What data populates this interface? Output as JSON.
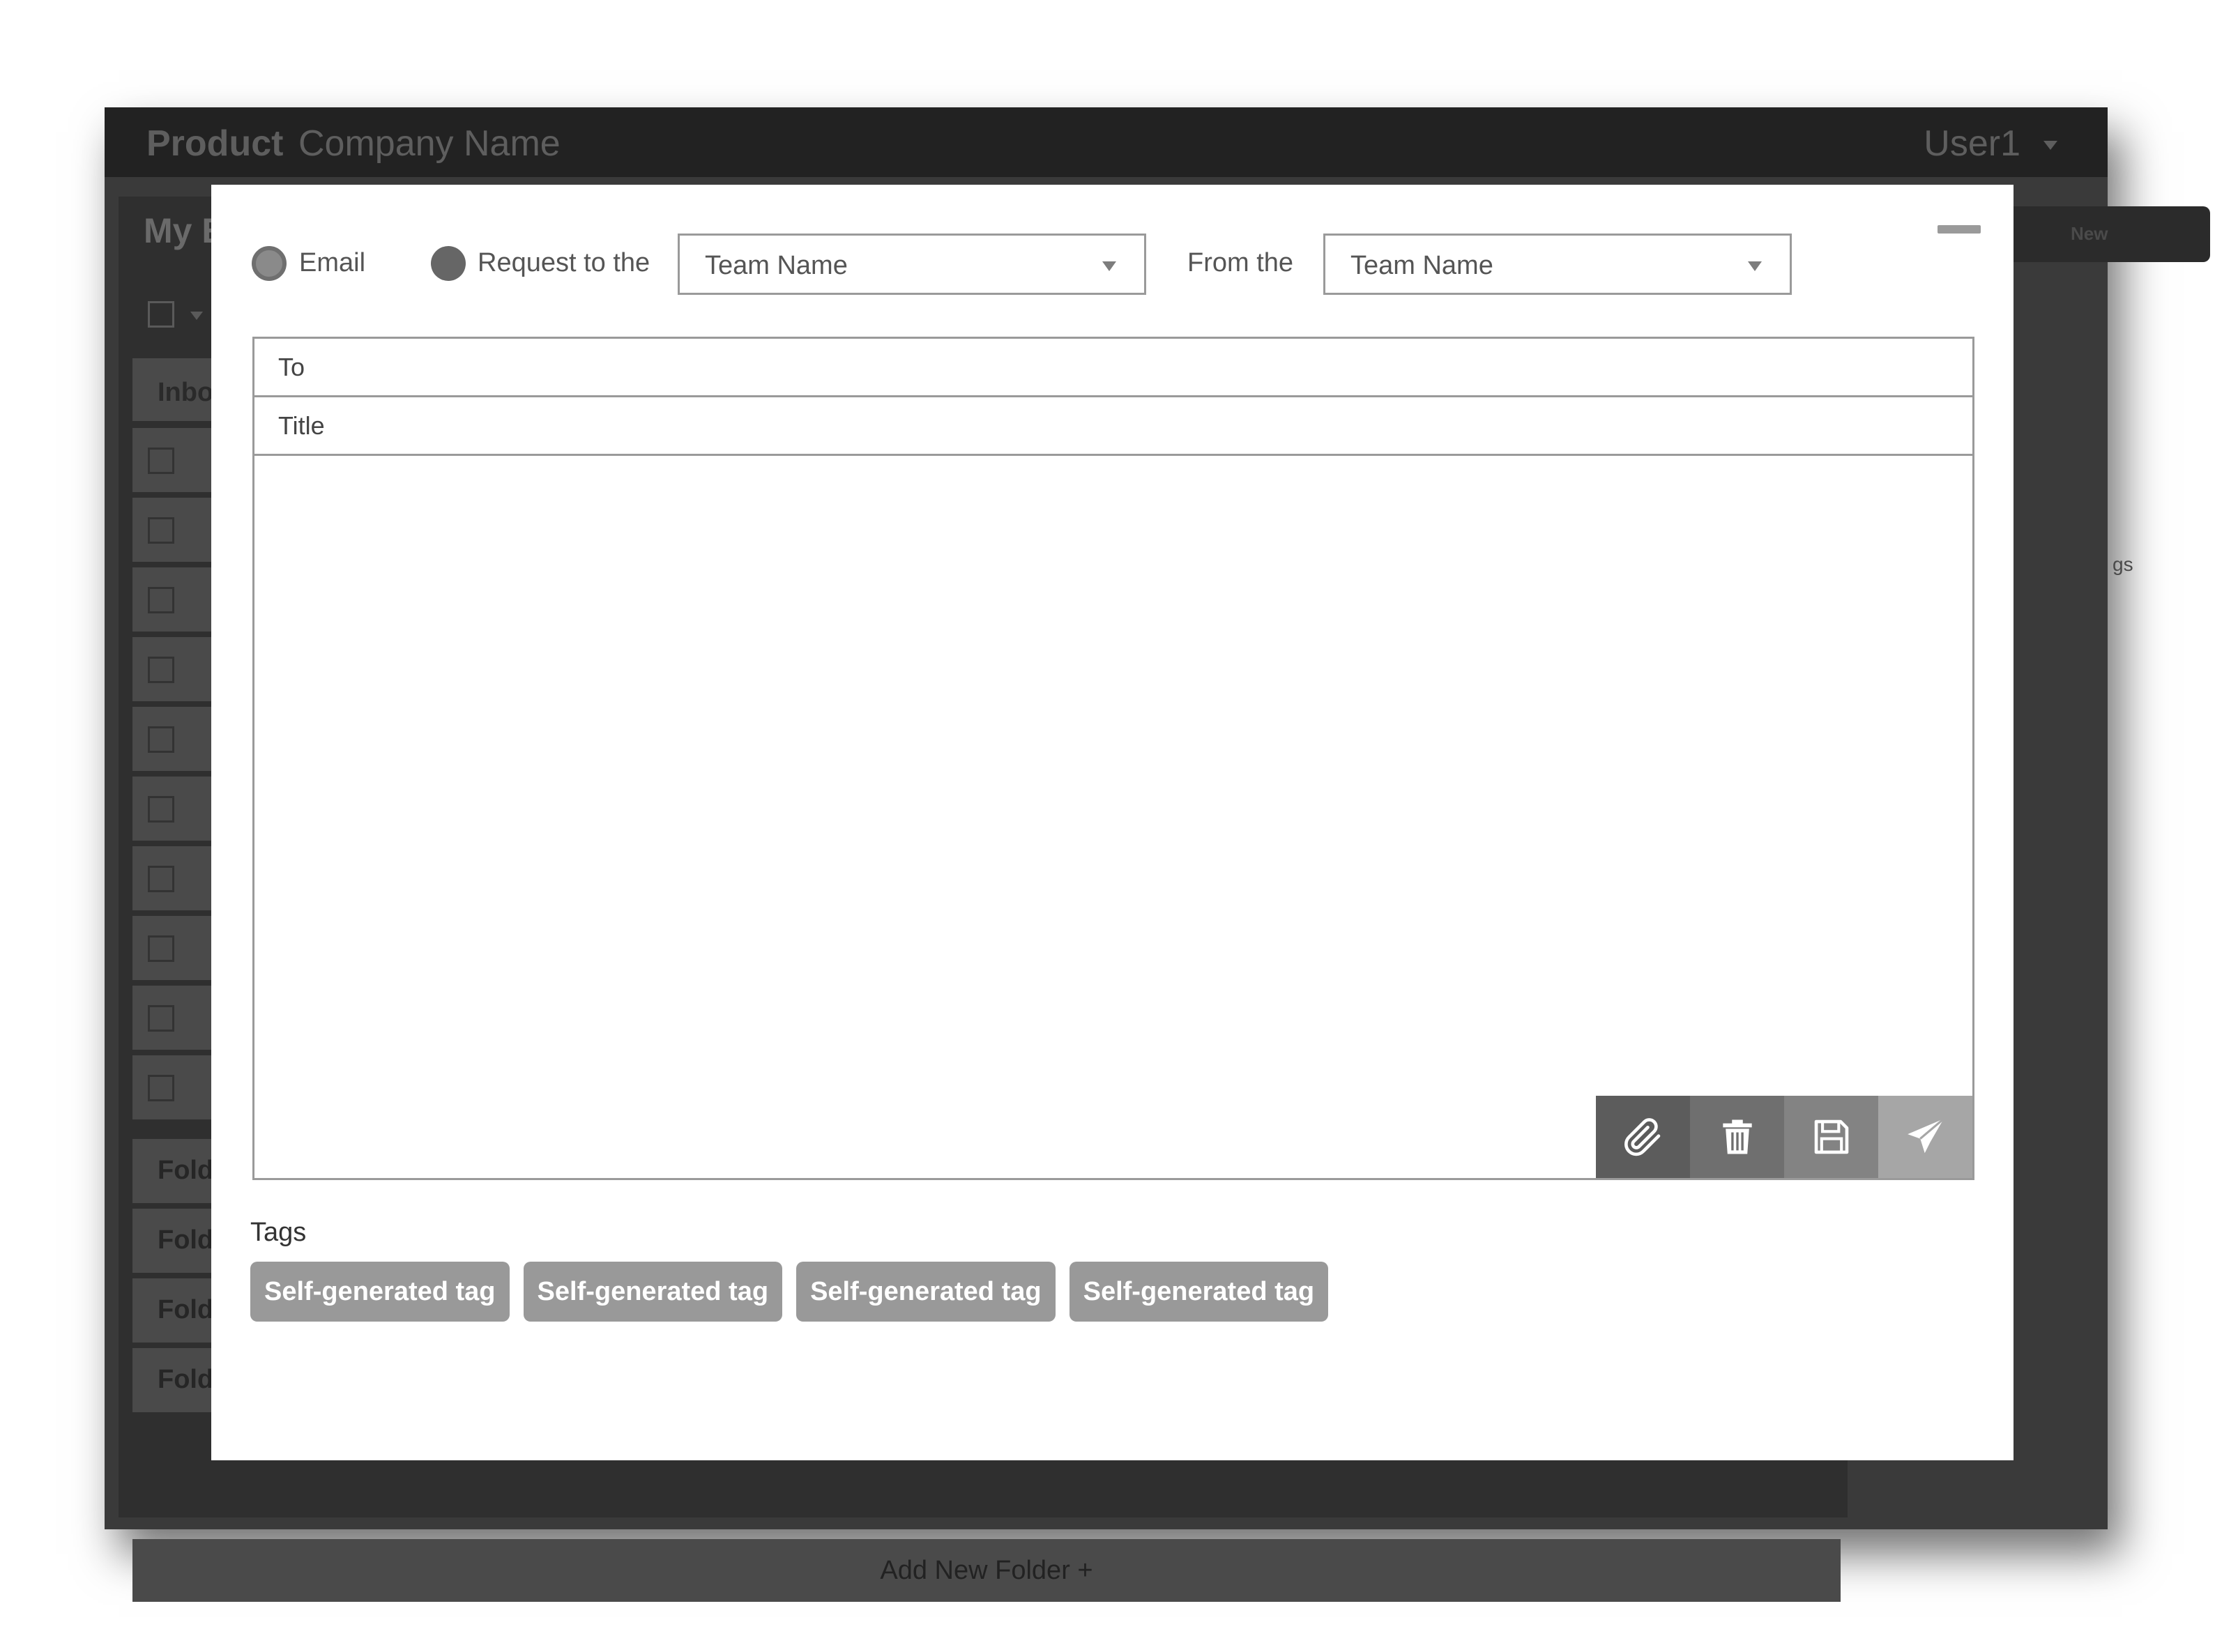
{
  "app": {
    "product": "Product",
    "company": "Company Name",
    "user": "User1"
  },
  "background": {
    "panel_title": "My E",
    "inbox_tab": "Inbox",
    "folders": [
      "Folde",
      "Folde",
      "Folde",
      "Folde"
    ],
    "add_folder": "Add New Folder +",
    "right_button": "New",
    "right_label": "gs"
  },
  "compose": {
    "type_email": "Email",
    "type_request": "Request to the",
    "request_team": "Team Name",
    "from_label": "From the",
    "from_team": "Team Name",
    "to_placeholder": "To",
    "title_placeholder": "Title",
    "toolbar": {
      "attach": "paperclip-icon",
      "delete": "trash-icon",
      "save": "floppy-disk-icon",
      "send": "paper-plane-icon"
    },
    "tags_label": "Tags",
    "tags": [
      "Self-generated tag",
      "Self-generated tag",
      "Self-generated tag",
      "Self-generated tag"
    ]
  }
}
